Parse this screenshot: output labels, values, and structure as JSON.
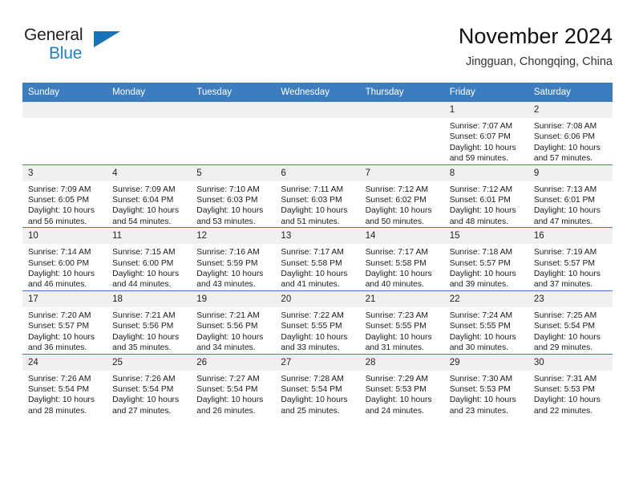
{
  "logo": {
    "word_one": "General",
    "word_two": "Blue",
    "accent_color": "#1772b8",
    "text_color": "#231f20",
    "triangle_icon": "triangle-icon"
  },
  "header": {
    "title": "November 2024",
    "location": "Jingguan, Chongqing, China"
  },
  "theme": {
    "header_blue": "#3c7dc0",
    "daynum_band": "#f0f0f0",
    "grid_line": "#3c7dc0"
  },
  "weekday_headers": [
    "Sunday",
    "Monday",
    "Tuesday",
    "Wednesday",
    "Thursday",
    "Friday",
    "Saturday"
  ],
  "weeks": [
    [
      {
        "day": "",
        "sunrise": "",
        "sunset": "",
        "daylight_line1": "",
        "daylight_line2": ""
      },
      {
        "day": "",
        "sunrise": "",
        "sunset": "",
        "daylight_line1": "",
        "daylight_line2": ""
      },
      {
        "day": "",
        "sunrise": "",
        "sunset": "",
        "daylight_line1": "",
        "daylight_line2": ""
      },
      {
        "day": "",
        "sunrise": "",
        "sunset": "",
        "daylight_line1": "",
        "daylight_line2": ""
      },
      {
        "day": "",
        "sunrise": "",
        "sunset": "",
        "daylight_line1": "",
        "daylight_line2": ""
      },
      {
        "day": "1",
        "sunrise": "Sunrise: 7:07 AM",
        "sunset": "Sunset: 6:07 PM",
        "daylight_line1": "Daylight: 10 hours",
        "daylight_line2": "and 59 minutes."
      },
      {
        "day": "2",
        "sunrise": "Sunrise: 7:08 AM",
        "sunset": "Sunset: 6:06 PM",
        "daylight_line1": "Daylight: 10 hours",
        "daylight_line2": "and 57 minutes."
      }
    ],
    [
      {
        "day": "3",
        "sunrise": "Sunrise: 7:09 AM",
        "sunset": "Sunset: 6:05 PM",
        "daylight_line1": "Daylight: 10 hours",
        "daylight_line2": "and 56 minutes."
      },
      {
        "day": "4",
        "sunrise": "Sunrise: 7:09 AM",
        "sunset": "Sunset: 6:04 PM",
        "daylight_line1": "Daylight: 10 hours",
        "daylight_line2": "and 54 minutes."
      },
      {
        "day": "5",
        "sunrise": "Sunrise: 7:10 AM",
        "sunset": "Sunset: 6:03 PM",
        "daylight_line1": "Daylight: 10 hours",
        "daylight_line2": "and 53 minutes."
      },
      {
        "day": "6",
        "sunrise": "Sunrise: 7:11 AM",
        "sunset": "Sunset: 6:03 PM",
        "daylight_line1": "Daylight: 10 hours",
        "daylight_line2": "and 51 minutes."
      },
      {
        "day": "7",
        "sunrise": "Sunrise: 7:12 AM",
        "sunset": "Sunset: 6:02 PM",
        "daylight_line1": "Daylight: 10 hours",
        "daylight_line2": "and 50 minutes."
      },
      {
        "day": "8",
        "sunrise": "Sunrise: 7:12 AM",
        "sunset": "Sunset: 6:01 PM",
        "daylight_line1": "Daylight: 10 hours",
        "daylight_line2": "and 48 minutes."
      },
      {
        "day": "9",
        "sunrise": "Sunrise: 7:13 AM",
        "sunset": "Sunset: 6:01 PM",
        "daylight_line1": "Daylight: 10 hours",
        "daylight_line2": "and 47 minutes."
      }
    ],
    [
      {
        "day": "10",
        "sunrise": "Sunrise: 7:14 AM",
        "sunset": "Sunset: 6:00 PM",
        "daylight_line1": "Daylight: 10 hours",
        "daylight_line2": "and 46 minutes."
      },
      {
        "day": "11",
        "sunrise": "Sunrise: 7:15 AM",
        "sunset": "Sunset: 6:00 PM",
        "daylight_line1": "Daylight: 10 hours",
        "daylight_line2": "and 44 minutes."
      },
      {
        "day": "12",
        "sunrise": "Sunrise: 7:16 AM",
        "sunset": "Sunset: 5:59 PM",
        "daylight_line1": "Daylight: 10 hours",
        "daylight_line2": "and 43 minutes."
      },
      {
        "day": "13",
        "sunrise": "Sunrise: 7:17 AM",
        "sunset": "Sunset: 5:58 PM",
        "daylight_line1": "Daylight: 10 hours",
        "daylight_line2": "and 41 minutes."
      },
      {
        "day": "14",
        "sunrise": "Sunrise: 7:17 AM",
        "sunset": "Sunset: 5:58 PM",
        "daylight_line1": "Daylight: 10 hours",
        "daylight_line2": "and 40 minutes."
      },
      {
        "day": "15",
        "sunrise": "Sunrise: 7:18 AM",
        "sunset": "Sunset: 5:57 PM",
        "daylight_line1": "Daylight: 10 hours",
        "daylight_line2": "and 39 minutes."
      },
      {
        "day": "16",
        "sunrise": "Sunrise: 7:19 AM",
        "sunset": "Sunset: 5:57 PM",
        "daylight_line1": "Daylight: 10 hours",
        "daylight_line2": "and 37 minutes."
      }
    ],
    [
      {
        "day": "17",
        "sunrise": "Sunrise: 7:20 AM",
        "sunset": "Sunset: 5:57 PM",
        "daylight_line1": "Daylight: 10 hours",
        "daylight_line2": "and 36 minutes."
      },
      {
        "day": "18",
        "sunrise": "Sunrise: 7:21 AM",
        "sunset": "Sunset: 5:56 PM",
        "daylight_line1": "Daylight: 10 hours",
        "daylight_line2": "and 35 minutes."
      },
      {
        "day": "19",
        "sunrise": "Sunrise: 7:21 AM",
        "sunset": "Sunset: 5:56 PM",
        "daylight_line1": "Daylight: 10 hours",
        "daylight_line2": "and 34 minutes."
      },
      {
        "day": "20",
        "sunrise": "Sunrise: 7:22 AM",
        "sunset": "Sunset: 5:55 PM",
        "daylight_line1": "Daylight: 10 hours",
        "daylight_line2": "and 33 minutes."
      },
      {
        "day": "21",
        "sunrise": "Sunrise: 7:23 AM",
        "sunset": "Sunset: 5:55 PM",
        "daylight_line1": "Daylight: 10 hours",
        "daylight_line2": "and 31 minutes."
      },
      {
        "day": "22",
        "sunrise": "Sunrise: 7:24 AM",
        "sunset": "Sunset: 5:55 PM",
        "daylight_line1": "Daylight: 10 hours",
        "daylight_line2": "and 30 minutes."
      },
      {
        "day": "23",
        "sunrise": "Sunrise: 7:25 AM",
        "sunset": "Sunset: 5:54 PM",
        "daylight_line1": "Daylight: 10 hours",
        "daylight_line2": "and 29 minutes."
      }
    ],
    [
      {
        "day": "24",
        "sunrise": "Sunrise: 7:26 AM",
        "sunset": "Sunset: 5:54 PM",
        "daylight_line1": "Daylight: 10 hours",
        "daylight_line2": "and 28 minutes."
      },
      {
        "day": "25",
        "sunrise": "Sunrise: 7:26 AM",
        "sunset": "Sunset: 5:54 PM",
        "daylight_line1": "Daylight: 10 hours",
        "daylight_line2": "and 27 minutes."
      },
      {
        "day": "26",
        "sunrise": "Sunrise: 7:27 AM",
        "sunset": "Sunset: 5:54 PM",
        "daylight_line1": "Daylight: 10 hours",
        "daylight_line2": "and 26 minutes."
      },
      {
        "day": "27",
        "sunrise": "Sunrise: 7:28 AM",
        "sunset": "Sunset: 5:54 PM",
        "daylight_line1": "Daylight: 10 hours",
        "daylight_line2": "and 25 minutes."
      },
      {
        "day": "28",
        "sunrise": "Sunrise: 7:29 AM",
        "sunset": "Sunset: 5:53 PM",
        "daylight_line1": "Daylight: 10 hours",
        "daylight_line2": "and 24 minutes."
      },
      {
        "day": "29",
        "sunrise": "Sunrise: 7:30 AM",
        "sunset": "Sunset: 5:53 PM",
        "daylight_line1": "Daylight: 10 hours",
        "daylight_line2": "and 23 minutes."
      },
      {
        "day": "30",
        "sunrise": "Sunrise: 7:31 AM",
        "sunset": "Sunset: 5:53 PM",
        "daylight_line1": "Daylight: 10 hours",
        "daylight_line2": "and 22 minutes."
      }
    ]
  ]
}
